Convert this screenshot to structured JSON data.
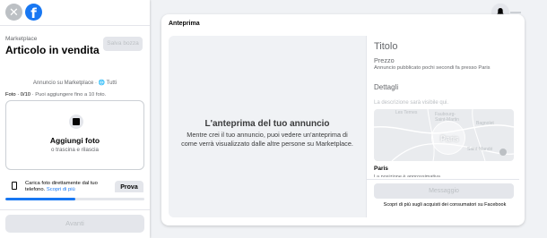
{
  "sidebar": {
    "close_glyph": "✕",
    "logo_glyph": "f",
    "breadcrumb": "Marketplace",
    "title": "Articolo in vendita",
    "save_draft_label": "Salva bozza",
    "visibility_note": "Annuncio su Marketplace · 🌐 Tutti",
    "photos_label": "Foto · 0/10",
    "photos_hint": " · Puoi aggiungere fino a 10 foto.",
    "upload": {
      "title": "Aggiungi foto",
      "subtitle": "o trascina e rilascia"
    },
    "phone": {
      "text": "Carica foto direttamente dal tuo telefono.",
      "link": "Scopri di più",
      "button": "Prova"
    },
    "progress_fraction": 0.5,
    "next_label": "Avanti"
  },
  "preview": {
    "card_title": "Anteprima",
    "heading": "L'anteprima del tuo annuncio",
    "description": "Mentre crei il tuo annuncio, puoi vedere un'anteprima di come verrà visualizzato dalle altre persone su Marketplace.",
    "details": {
      "title": "Titolo",
      "price": "Prezzo",
      "posted": "Annuncio pubblicato pochi secondi fa presso Paris",
      "section": "Dettagli",
      "description_placeholder": "La descrizione sarà visibile qui.",
      "map": {
        "labels": [
          "Les Ternes",
          "Faubourg-Saint-Martin",
          "Bagnolet",
          "Paris",
          "Saint-Mandé"
        ]
      },
      "location": "Paris",
      "location_sub": "La posizione è approssimativa",
      "message_button": "Messaggio",
      "disclaimer": "Scopri di più sugli acquisti dei consumatori su Facebook"
    }
  },
  "icons": {
    "close": "close-icon",
    "logo": "facebook-logo-icon",
    "add_photo": "add-photo-icon",
    "phone": "phone-icon",
    "notifications": "bell-icon",
    "map_info": "info-icon"
  },
  "colors": {
    "accent": "#1877f2",
    "page_bg": "#f0f2f5",
    "disabled_text": "#bcc0c4"
  }
}
